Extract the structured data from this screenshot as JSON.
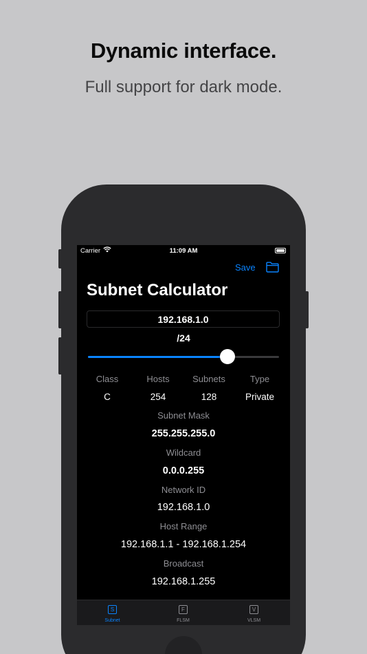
{
  "promo": {
    "headline": "Dynamic interface.",
    "subhead": "Full support for dark mode."
  },
  "status_bar": {
    "carrier": "Carrier",
    "time": "11:09 AM",
    "icons": [
      "wifi-icon",
      "battery-icon"
    ]
  },
  "nav": {
    "save_label": "Save",
    "folder_icon": "folder-icon"
  },
  "app": {
    "title": "Subnet Calculator",
    "ip_value": "192.168.1.0",
    "cidr_label": "/24",
    "prefix_fraction": 0.73
  },
  "summary": {
    "headers": [
      "Class",
      "Hosts",
      "Subnets",
      "Type"
    ],
    "values": [
      "C",
      "254",
      "128",
      "Private"
    ]
  },
  "details": {
    "subnet_mask_label": "Subnet Mask",
    "subnet_mask_value": "255.255.255.0",
    "wildcard_label": "Wildcard",
    "wildcard_value": "0.0.0.255",
    "network_id_label": "Network ID",
    "network_id_value": "192.168.1.0",
    "host_range_label": "Host Range",
    "host_range_value": "192.168.1.1 - 192.168.1.254",
    "broadcast_label": "Broadcast",
    "broadcast_value": "192.168.1.255"
  },
  "tabs": [
    {
      "label": "Subnet",
      "glyph": "S",
      "active": true
    },
    {
      "label": "FLSM",
      "glyph": "F",
      "active": false
    },
    {
      "label": "VLSM",
      "glyph": "V",
      "active": false
    }
  ],
  "colors": {
    "accent": "#0a84ff",
    "background": "#c7c7c9",
    "screen": "#000000",
    "secondary_text": "#8e8e93"
  }
}
